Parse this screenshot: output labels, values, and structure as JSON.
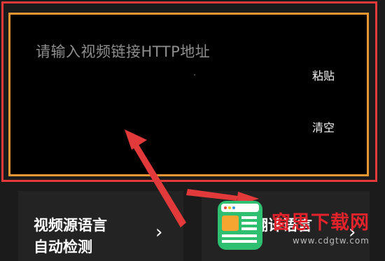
{
  "input": {
    "placeholder": "请输入视频链接HTTP地址",
    "paste_label": "粘贴",
    "clear_label": "清空"
  },
  "cards": {
    "source_language_title": "视频源语言",
    "source_language_value": "自动检测",
    "translate_language_title": "翻译语言"
  },
  "watermark": {
    "text": "窗思下载网",
    "url": "www.cdgtw.com"
  },
  "colors": {
    "panel_border": "#e8962f",
    "highlight_frame": "#e23a3a",
    "arrow": "#e23a3a",
    "background": "#1b1b1b"
  }
}
